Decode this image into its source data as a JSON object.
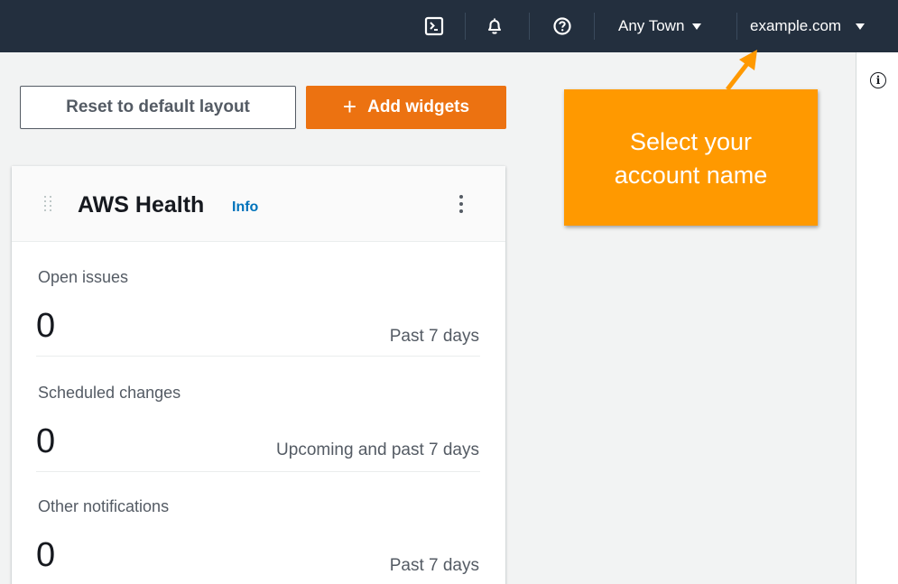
{
  "topnav": {
    "cloudshell_icon": "cloudshell-icon",
    "notifications_icon": "bell-icon",
    "help_icon": "help-icon",
    "region_label": "Any Town",
    "account_label": "example.com"
  },
  "toolbar": {
    "reset_label": "Reset to default layout",
    "add_widgets_label": "Add widgets"
  },
  "widget": {
    "title": "AWS Health",
    "info_link": "Info",
    "metrics": [
      {
        "label": "Open issues",
        "value": "0",
        "period": "Past 7 days"
      },
      {
        "label": "Scheduled changes",
        "value": "0",
        "period": "Upcoming and past 7 days"
      },
      {
        "label": "Other notifications",
        "value": "0",
        "period": "Past 7 days"
      }
    ]
  },
  "callout": {
    "line1": "Select your",
    "line2": "account name"
  },
  "side_panel": {
    "info_icon": "info-icon",
    "info_glyph": "i"
  },
  "colors": {
    "nav_background": "#232f3e",
    "primary_button": "#ec7211",
    "callout": "#ff9900",
    "link": "#0073bb"
  }
}
